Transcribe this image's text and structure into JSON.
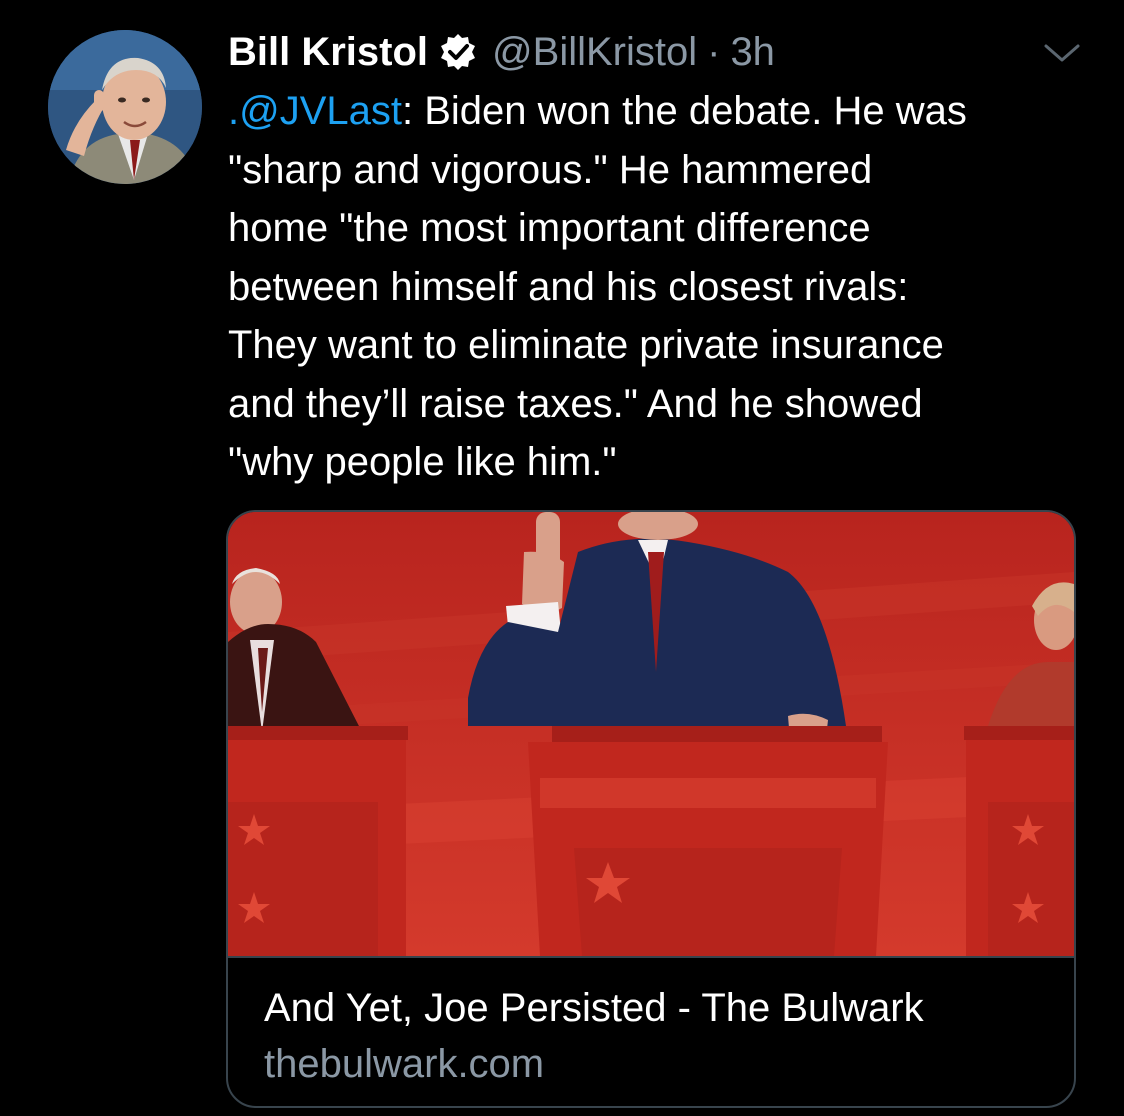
{
  "tweet": {
    "author": {
      "name": "Bill Kristol",
      "handle": "@BillKristol",
      "separator": "·",
      "time": "3h",
      "verified": true,
      "avatar_icon": "profile-photo"
    },
    "menu_icon": "chevron-down-icon",
    "text": {
      "mention": ".@JVLast",
      "line1_rest": ": Biden won the debate. He was",
      "line2": "\"sharp and vigorous.\" He hammered",
      "line3": "home \"the most important difference",
      "line4": "between himself and his closest rivals:",
      "line5": "They want to eliminate private insurance",
      "line6": "and they’ll raise taxes.\" And he showed",
      "line7": "\"why people like him.\""
    },
    "card": {
      "title": "And Yet, Joe Persisted - The Bulwark",
      "domain": "thebulwark.com",
      "image_icon": "debate-photo"
    }
  },
  "colors": {
    "background": "#000000",
    "text": "#ffffff",
    "secondary": "#8b98a5",
    "link": "#1da1f2",
    "border": "#38444d",
    "image_red": "#c22a22"
  }
}
